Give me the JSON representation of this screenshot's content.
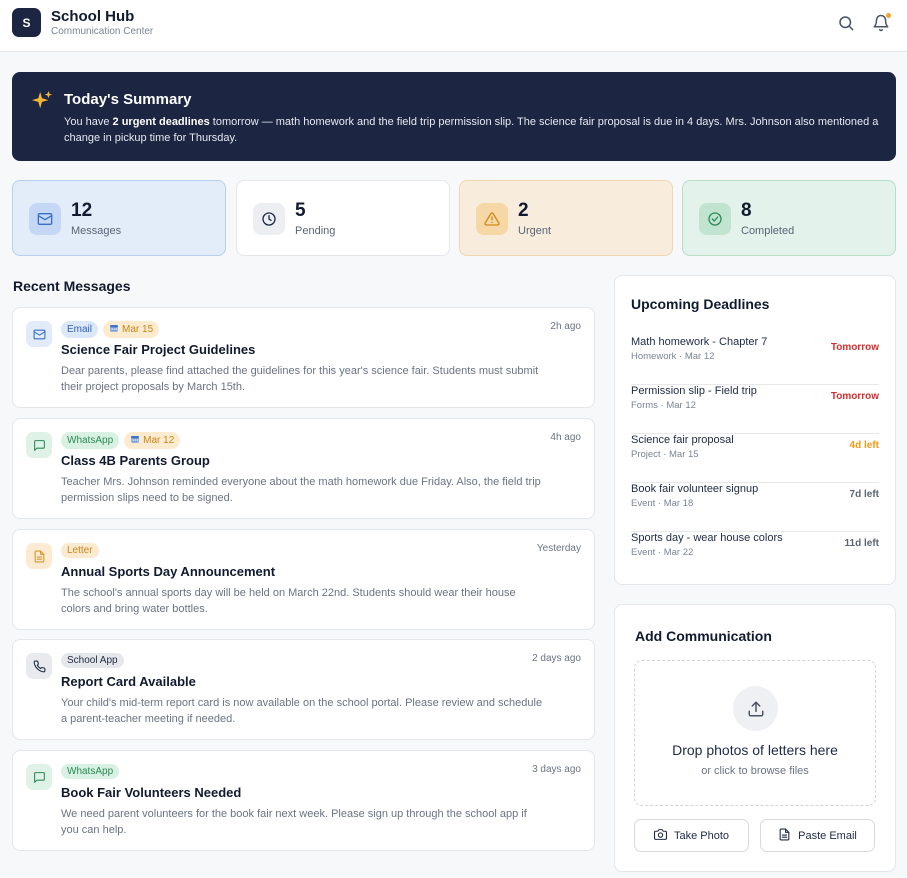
{
  "app": {
    "logo_letter": "S",
    "title": "School Hub",
    "subtitle": "Communication Center"
  },
  "header": {
    "icons": [
      "search-icon",
      "bell-icon"
    ]
  },
  "summary": {
    "icon": "sparkles-icon",
    "title": "Today's Summary",
    "text_before": "You have ",
    "text_bold": "2 urgent deadlines",
    "text_after": " tomorrow — math homework and the field trip permission slip. The science fair proposal is due in 4 days. Mrs. Johnson also mentioned a change in pickup time for Thursday."
  },
  "stats": [
    {
      "value": "12",
      "label": "Messages",
      "icon": "mail-icon",
      "bg": "#e3ecf9",
      "border": "#b9cdee",
      "icon_bg": "#c4d8f5",
      "icon_color": "#3b6fc4"
    },
    {
      "value": "5",
      "label": "Pending",
      "icon": "clock-icon",
      "bg": "#ffffff",
      "border": "#e3e6eb",
      "icon_bg": "#eceef2",
      "icon_color": "#1e2a44"
    },
    {
      "value": "2",
      "label": "Urgent",
      "icon": "alert-triangle-icon",
      "bg": "#f8ecdd",
      "border": "#f0d6b3",
      "icon_bg": "#f6d7a6",
      "icon_color": "#d08a1a"
    },
    {
      "value": "8",
      "label": "Completed",
      "icon": "check-circle-icon",
      "bg": "#e3f2ea",
      "border": "#b9dec8",
      "icon_bg": "#c0e4cf",
      "icon_color": "#2f8a57"
    }
  ],
  "recent": {
    "title": "Recent Messages",
    "messages": [
      {
        "type": "email",
        "icon": "mail-icon",
        "tag": "Email",
        "date_tag": "Mar 15",
        "time": "2h ago",
        "title": "Science Fair Project Guidelines",
        "text": "Dear parents, please find attached the guidelines for this year's science fair. Students must submit their project proposals by March 15th."
      },
      {
        "type": "whatsapp",
        "icon": "message-icon",
        "tag": "WhatsApp",
        "date_tag": "Mar 12",
        "time": "4h ago",
        "title": "Class 4B Parents Group",
        "text": "Teacher Mrs. Johnson reminded everyone about the math homework due Friday. Also, the field trip permission slips need to be signed."
      },
      {
        "type": "letter",
        "icon": "document-icon",
        "tag": "Letter",
        "date_tag": "",
        "time": "Yesterday",
        "title": "Annual Sports Day Announcement",
        "text": "The school's annual sports day will be held on March 22nd. Students should wear their house colors and bring water bottles."
      },
      {
        "type": "app",
        "icon": "phone-icon",
        "tag": "School App",
        "date_tag": "",
        "time": "2 days ago",
        "title": "Report Card Available",
        "text": "Your child's mid-term report card is now available on the school portal. Please review and schedule a parent-teacher meeting if needed."
      },
      {
        "type": "whatsapp",
        "icon": "message-icon",
        "tag": "WhatsApp",
        "date_tag": "",
        "time": "3 days ago",
        "title": "Book Fair Volunteers Needed",
        "text": "We need parent volunteers for the book fair next week. Please sign up through the school app if you can help."
      }
    ]
  },
  "deadlines": {
    "title": "Upcoming Deadlines",
    "items": [
      {
        "name": "Math homework - Chapter 7",
        "meta": "Homework · Mar 12",
        "status": "Tomorrow",
        "color": "#d32f2f"
      },
      {
        "name": "Permission slip - Field trip",
        "meta": "Forms · Mar 12",
        "status": "Tomorrow",
        "color": "#d32f2f"
      },
      {
        "name": "Science fair proposal",
        "meta": "Project · Mar 15",
        "status": "4d left",
        "color": "#f09a16"
      },
      {
        "name": "Book fair volunteer signup",
        "meta": "Event · Mar 18",
        "status": "7d left",
        "color": "#5b6475"
      },
      {
        "name": "Sports day - wear house colors",
        "meta": "Event · Mar 22",
        "status": "11d left",
        "color": "#5b6475"
      }
    ]
  },
  "add": {
    "title": "Add Communication",
    "drop_title": "Drop photos of letters here",
    "drop_sub": "or click to browse files",
    "take_photo": "Take Photo",
    "paste_email": "Paste Email"
  },
  "tag_colors": {
    "email": {
      "bg": "#dbe8fa",
      "fg": "#2f62b8",
      "icon_bg": "#e1ebf9",
      "icon_fg": "#3b6fc4"
    },
    "whatsapp": {
      "bg": "#d9f1e3",
      "fg": "#2b8a55",
      "icon_bg": "#dff2e7",
      "icon_fg": "#2f8a57"
    },
    "letter": {
      "bg": "#fbead0",
      "fg": "#c9861b",
      "icon_bg": "#fcebd2",
      "icon_fg": "#d6952c"
    },
    "app": {
      "bg": "#e5e7eb",
      "fg": "#1e2a44",
      "icon_bg": "#e8eaee",
      "icon_fg": "#1e2a44"
    },
    "date": {
      "bg": "#fdebd0",
      "fg": "#c9861b"
    }
  }
}
